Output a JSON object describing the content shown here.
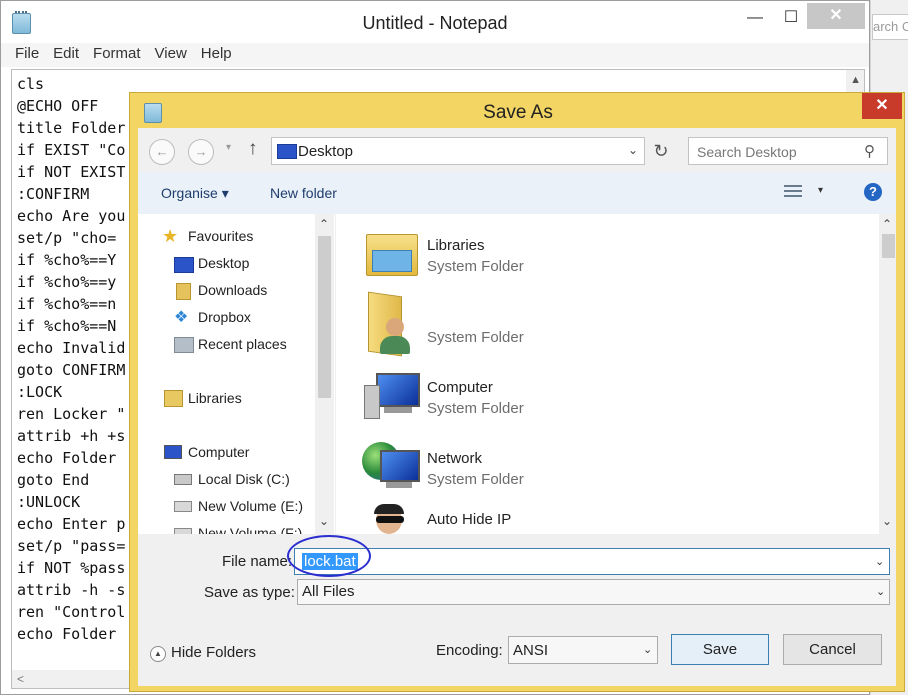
{
  "background": {
    "search_fragment": "arch C"
  },
  "notepad": {
    "title": "Untitled - Notepad",
    "controls": {
      "minimize": "—",
      "maximize": "☐",
      "close": "✕"
    },
    "menu": [
      "File",
      "Edit",
      "Format",
      "View",
      "Help"
    ],
    "lines": [
      "cls",
      "@ECHO OFF",
      "title Folder",
      "if EXIST \"Co",
      "if NOT EXIST",
      ":CONFIRM",
      "echo Are you",
      "set/p \"cho=",
      "if %cho%==Y",
      "if %cho%==y",
      "if %cho%==n",
      "if %cho%==N",
      "echo Invalid",
      "goto CONFIRM",
      ":LOCK",
      "ren Locker \"",
      "attrib +h +s",
      "echo Folder",
      "goto End",
      ":UNLOCK",
      "echo Enter p",
      "set/p \"pass=",
      "if NOT %pass",
      "attrib -h -s",
      "ren \"Control",
      "echo Folder"
    ]
  },
  "dialog": {
    "title": "Save As",
    "close": "✕",
    "address": {
      "location": "Desktop"
    },
    "search_placeholder": "Search Desktop",
    "toolbar": {
      "organise": "Organise ▾",
      "new_folder": "New folder"
    },
    "nav": {
      "favourites_header": "Favourites",
      "favourites": [
        "Desktop",
        "Downloads",
        "Dropbox",
        "Recent places"
      ],
      "libraries": "Libraries",
      "computer_header": "Computer",
      "drives": [
        "Local Disk (C:)",
        "New Volume (E:)",
        "New Volume (F:)"
      ]
    },
    "files": [
      {
        "name": "Libraries",
        "type": "System Folder",
        "icon": "libraries-icon"
      },
      {
        "name": "",
        "type": "System Folder",
        "icon": "user-folder-icon"
      },
      {
        "name": "Computer",
        "type": "System Folder",
        "icon": "computer-icon"
      },
      {
        "name": "Network",
        "type": "System Folder",
        "icon": "network-icon"
      },
      {
        "name": "Auto Hide IP",
        "type": "",
        "icon": "auto-hide-ip-icon"
      }
    ],
    "file_name_label": "File name:",
    "file_name_value": "lock.bat",
    "save_type_label": "Save as type:",
    "save_type_value": "All Files",
    "hide_folders": "Hide Folders",
    "encoding_label": "Encoding:",
    "encoding_value": "ANSI",
    "save_button": "Save",
    "cancel_button": "Cancel",
    "accent_color": "#f2d563",
    "close_color": "#c83a2a",
    "selection_color": "#3399ff"
  }
}
